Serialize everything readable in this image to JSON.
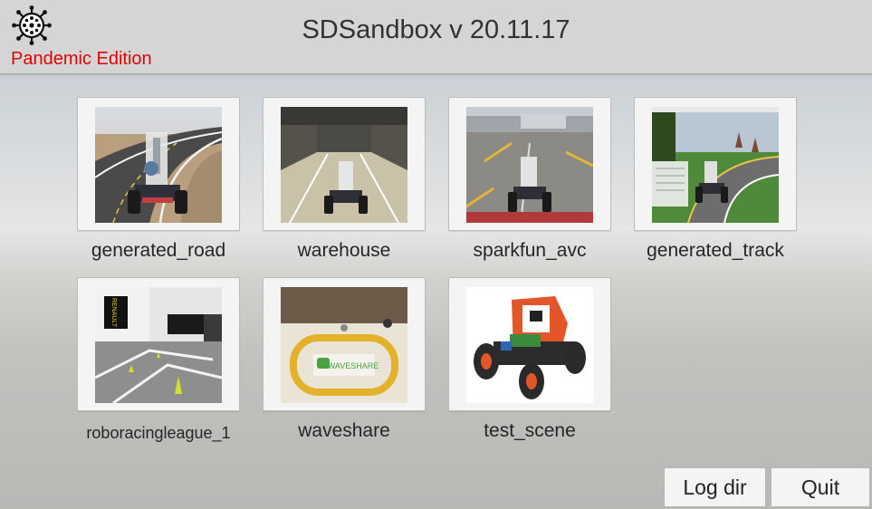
{
  "header": {
    "title": "SDSandbox v 20.11.17",
    "edition": "Pandemic Edition",
    "edition_color": "#e00000",
    "logo_icon": "virus-icon"
  },
  "scenes": [
    {
      "label": "generated_road"
    },
    {
      "label": "warehouse"
    },
    {
      "label": "sparkfun_avc"
    },
    {
      "label": "generated_track"
    },
    {
      "label": "roboracingleague_1"
    },
    {
      "label": "waveshare"
    },
    {
      "label": "test_scene"
    }
  ],
  "buttons": {
    "log_dir": "Log dir",
    "quit": "Quit"
  }
}
